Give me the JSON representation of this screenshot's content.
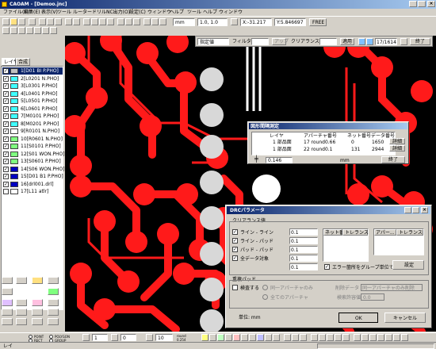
{
  "app": {
    "title": "CAOAM - [Demoo.jnc]",
    "menu": [
      "ファイル(F)",
      "編集(E)",
      "表示(V)",
      "ツール",
      "ルーター",
      "ドリル",
      "NC出力(O)",
      "設定(C)",
      "ウィンドウ",
      "ヘルプ",
      "ツール",
      "ヘルプ",
      "ウィンドウ"
    ]
  },
  "toolbar": {
    "unit": "mm",
    "zoom": "1.0, 1.0",
    "coord_x": "X:-31.217",
    "coord_y": "Y:5.846697",
    "free": "FREE"
  },
  "search_bar": {
    "mode": "指定値",
    "filter_label": "フィルタ:",
    "apply_label": "アップ",
    "clearance_label": "クリアランス値",
    "apply2": "適用",
    "page": "17/1614",
    "end": "終了"
  },
  "layer_panel": {
    "tabs": [
      "レイヤ",
      "合成"
    ],
    "layers": [
      {
        "name": "1[D01 BI P.PHO]",
        "color": "#c0c0c0",
        "checked": true,
        "selected": true
      },
      {
        "name": "2[L0201 N.PHO]",
        "color": "#40ffff",
        "checked": true
      },
      {
        "name": "3[L0301 P.PHO]",
        "color": "#40ffff",
        "checked": true
      },
      {
        "name": "4[L0401 P.PHO]",
        "color": "#40ffff",
        "checked": true
      },
      {
        "name": "5[L0501 P.PHO]",
        "color": "#40ffff",
        "checked": true
      },
      {
        "name": "6[L0601 P.PHO]",
        "color": "#40ffff",
        "checked": true
      },
      {
        "name": "7[M0101 P.PHO]",
        "color": "#40ffff",
        "checked": true
      },
      {
        "name": "8[M0201 P.PHO]",
        "color": "#40ffff",
        "checked": true
      },
      {
        "name": "9[R0101 N.PHO]",
        "color": "#ffffff",
        "checked": true
      },
      {
        "name": "10[R0601 N.PHO]",
        "color": "#80ff80",
        "checked": true
      },
      {
        "name": "11[S0101 P.PHO]",
        "color": "#80ff80",
        "checked": true
      },
      {
        "name": "12[S01 WON.PHO]",
        "color": "#80ff80",
        "checked": true
      },
      {
        "name": "13[S0601 P.PHO]",
        "color": "#80ff80",
        "checked": true
      },
      {
        "name": "14[S06 WON.PHO]",
        "color": "#0000c0",
        "checked": true
      },
      {
        "name": "15[D01 B1 P.PHO]",
        "color": "#0000c0",
        "checked": true
      },
      {
        "name": "16[drl001.drl]",
        "color": "#0000c0",
        "checked": true
      },
      {
        "name": "17[L11 atlr]",
        "color": "#ffffff",
        "checked": false
      }
    ]
  },
  "measure_dialog": {
    "title": "図形間隔測定",
    "headers": [
      "レイヤ",
      "アパーチャ番号",
      "ネット番号",
      "データ番号"
    ],
    "rows": [
      {
        "layer": "1 部品面",
        "aperture": "17 round0.66",
        "net": "0",
        "data": "1650",
        "action": "詳細"
      },
      {
        "layer": "1 部品面",
        "aperture": "22 round0.1",
        "net": "131",
        "data": "2944",
        "action": "詳細"
      }
    ],
    "distance": "0.146",
    "distance_unit": "mm",
    "ok": "終了"
  },
  "drc_dialog": {
    "title": "DRCパラメータ",
    "group_clearance": "クリアランス値",
    "checks": [
      {
        "label": "ライン - ライン",
        "value": "0.1",
        "checked": true
      },
      {
        "label": "ライン - パッド",
        "value": "0.1",
        "checked": true
      },
      {
        "label": "パッド - パッド",
        "value": "0.1",
        "checked": true
      },
      {
        "label": "全データ対象",
        "value": "0.1",
        "checked": true
      }
    ],
    "extra_value": "0.1",
    "group_checkbox": "エラー箇所をグループ単位で表示",
    "table1_headers": [
      "ネット番",
      "トレランス"
    ],
    "table2_headers": [
      "アパー...",
      "トレランス"
    ],
    "settings_button": "設定",
    "overlap_group": "重複パッド",
    "overlap_check": "検査する",
    "radio1": "同一アパーチャのみ",
    "radio2": "全てのアパーチャ",
    "delete_label": "削除データ",
    "delete_value": "同一アパーチャのみ削除",
    "tolerance_label": "検索許容値",
    "tolerance_value": "0.0",
    "unit_label": "単位: mm",
    "ok": "OK",
    "cancel": "キャンセル"
  },
  "bottom_toolbar": {
    "point": "POINT",
    "polygon": "POLYGON",
    "rect": "RECT",
    "group": "GROUP",
    "val1": "1",
    "val2": "0",
    "val3": "10",
    "round": "round",
    "round_size": "0.254"
  },
  "status_bar": {
    "left": "レイ"
  }
}
